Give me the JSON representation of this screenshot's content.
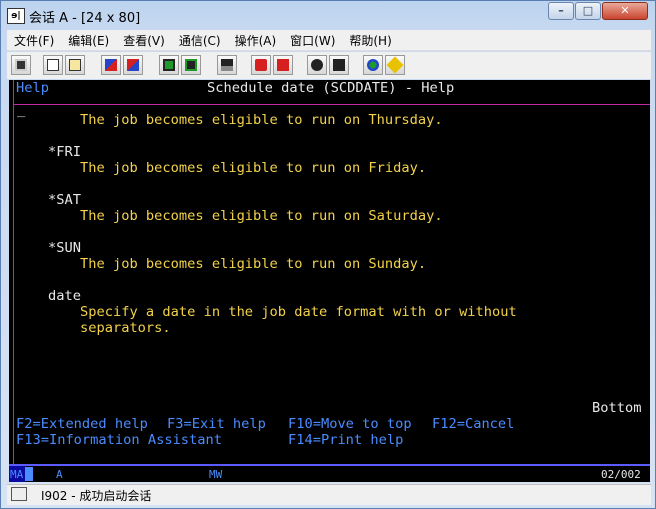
{
  "window": {
    "icon_text": "ɘ|",
    "title": "会话 A - [24 x 80]",
    "minimize": "–",
    "maximize": "□",
    "close": "✕"
  },
  "menu": [
    "文件(F)",
    "编辑(E)",
    "查看(V)",
    "通信(C)",
    "操作(A)",
    "窗口(W)",
    "帮助(H)"
  ],
  "toolbar": {
    "buttons": [
      "print-icon",
      "copy-icon",
      "paste-icon",
      "send-icon",
      "receive-icon",
      "display-icon",
      "keypad-icon",
      "macro-icon",
      "record-icon",
      "stop-icon",
      "play-icon",
      "play-step-icon",
      "globe-icon",
      "help-icon"
    ],
    "colors": {
      "red": "#d62020",
      "green": "#1f9a2a",
      "blue": "#2346c9",
      "yellow": "#e8c200"
    }
  },
  "terminal": {
    "header_left": "Help",
    "header_title": "Schedule date (SCDDATE) - Help",
    "entries": [
      {
        "keyword": "",
        "desc": "The job becomes eligible to run on Thursday."
      },
      {
        "keyword": "*FRI",
        "desc": "The job becomes eligible to run on Friday."
      },
      {
        "keyword": "*SAT",
        "desc": "The job becomes eligible to run on Saturday."
      },
      {
        "keyword": "*SUN",
        "desc": "The job becomes eligible to run on Sunday."
      },
      {
        "keyword": "date",
        "desc": "Specify a date in the job date format with or without",
        "desc2": "separators."
      }
    ],
    "bottom_marker": "Bottom",
    "fkeys_row1": [
      "F2=Extended help",
      "F3=Exit help",
      "F10=Move to top",
      "F12=Cancel"
    ],
    "fkeys_row2": [
      "F13=Information Assistant",
      "F14=Print help"
    ],
    "status": {
      "left": "MA",
      "a": "A",
      "mw": "MW",
      "pos": "02/002"
    },
    "colors": {
      "blue": "#4a8cff",
      "white": "#e8e8e8",
      "yellow": "#f2d24a",
      "pink": "#c22aa0"
    }
  },
  "statusbar": {
    "text": "I902  -  成功启动会话"
  }
}
